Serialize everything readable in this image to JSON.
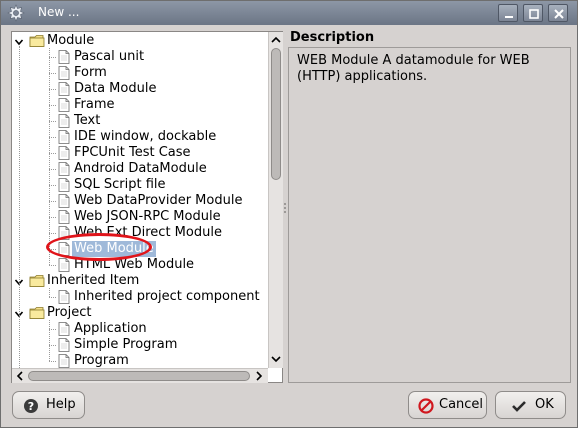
{
  "window": {
    "title": "New ...",
    "app_icon": "gear-icon"
  },
  "tree": {
    "groups": [
      {
        "label": "Module",
        "items": [
          "Pascal unit",
          "Form",
          "Data Module",
          "Frame",
          "Text",
          "IDE window, dockable",
          "FPCUnit Test Case",
          "Android DataModule",
          "SQL Script file",
          "Web DataProvider Module",
          "Web JSON-RPC Module",
          "Web Ext Direct Module",
          "Web Module",
          "HTML Web Module"
        ]
      },
      {
        "label": "Inherited Item",
        "items": [
          "Inherited project component"
        ]
      },
      {
        "label": "Project",
        "items": [
          "Application",
          "Simple Program",
          "Program"
        ]
      }
    ],
    "selected": "Web Module"
  },
  "description": {
    "title": "Description",
    "text": "WEB Module A datamodule for WEB (HTTP) applications."
  },
  "buttons": {
    "help": "Help",
    "cancel": "Cancel",
    "ok": "OK"
  },
  "colors": {
    "selection": "#9fb9d9",
    "highlight_ring": "#e0141a"
  }
}
